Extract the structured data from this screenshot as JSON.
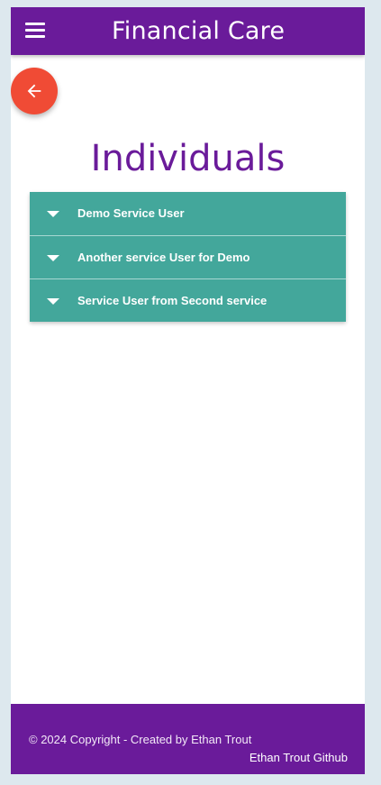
{
  "navbar": {
    "brand": "Financial Care",
    "menu_icon": "hamburger-menu-icon"
  },
  "back_button": {
    "icon": "arrow-left-icon",
    "color": "#f04b35"
  },
  "page": {
    "title": "Individuals"
  },
  "individuals": [
    {
      "label": "Demo Service User",
      "icon": "caret-down-icon"
    },
    {
      "label": "Another service User for Demo",
      "icon": "caret-down-icon"
    },
    {
      "label": "Service User from Second service",
      "icon": "caret-down-icon"
    }
  ],
  "footer": {
    "copyright": "© 2024 Copyright - Created by Ethan Trout",
    "github_link": "Ethan Trout Github"
  },
  "colors": {
    "primary": "#6a1b9a",
    "accent": "#43a79b",
    "fab": "#f04b35",
    "page_background": "#dde8ee"
  }
}
